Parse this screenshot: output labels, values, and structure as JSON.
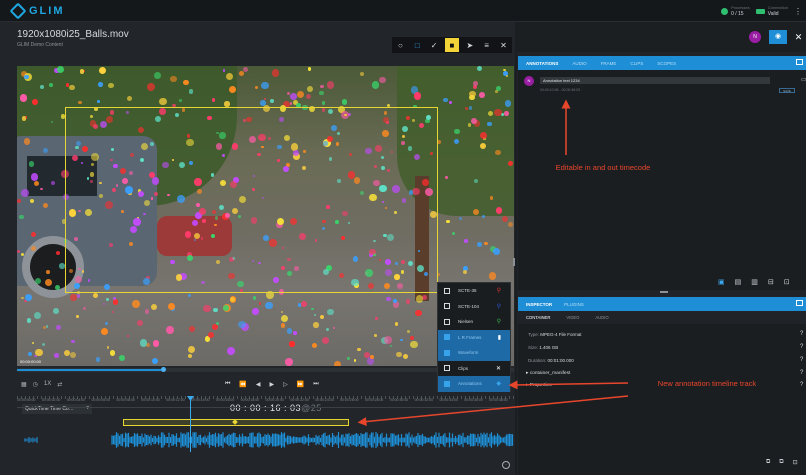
{
  "app": {
    "name": "GLIM"
  },
  "header_stats": [
    {
      "label": "Processes",
      "value": "0 / 15",
      "color": "#2fbf71"
    },
    {
      "label": "Connection",
      "value": "Valid",
      "color": "#2fbf71"
    }
  ],
  "header_menu_icon": "⋮",
  "file": {
    "title": "1920x1080i25_Balls.mov",
    "subtitle": "GLIM Demo Content"
  },
  "toolbar_icons": [
    "circle-tool",
    "rect-tool",
    "freehand-tool",
    "note-tool",
    "pointer-tool",
    "list-tool",
    "close-tool"
  ],
  "player": {
    "overlay_timecode": "00:00:00:00",
    "speed": "1X",
    "progress_fraction": 0.29,
    "transport_icons": [
      "⏮",
      "⏪",
      "◀",
      "▶",
      "▷",
      "⏩",
      "⏭"
    ]
  },
  "timeline": {
    "timecode_mode": "QuickTime Time Co…",
    "timecode": "00 : 00 : 16 : 03",
    "timecode_fps": "@25",
    "ruler_ticks": [
      "00:00:00:00",
      "00:00:02:00",
      "00:00:04:00",
      "00:00:06:00",
      "00:00:08:00",
      "00:00:10:00",
      "00:00:12:00",
      "00:00:14:00",
      "00:00:16:00",
      "00:00:18:00",
      "00:00:20:00",
      "00:00:22:00",
      "00:00:24:00",
      "00:00:26:00",
      "00:00:28:00",
      "00:00:30:00",
      "00:00:32:00",
      "00:00:34:00",
      "00:00:36:00",
      "00:00:38:00"
    ]
  },
  "track_menu": [
    {
      "label": "SCTE-35",
      "checked": false,
      "icon": "marker-red",
      "color": "#e0362c"
    },
    {
      "label": "SCTE-104",
      "checked": false,
      "icon": "marker-blue",
      "color": "#2a56d8"
    },
    {
      "label": "Nielsen",
      "checked": false,
      "icon": "marker-green",
      "color": "#3bb54a"
    },
    {
      "label": "L R Frames",
      "checked": true,
      "icon": "bar",
      "color": "#ffffff"
    },
    {
      "label": "Waveform",
      "checked": true,
      "icon": "",
      "color": ""
    },
    {
      "label": "Clips",
      "checked": false,
      "icon": "scissors",
      "color": "#ffffff"
    },
    {
      "label": "Annotations",
      "checked": true,
      "icon": "tag",
      "color": "#36a3ea"
    }
  ],
  "annotations_panel": {
    "tabs": [
      "ANNOTATIONS",
      "AUDIO",
      "FRAME",
      "CLIPS",
      "SCOPES"
    ],
    "active_tab": "ANNOTATIONS",
    "user_initial": "N",
    "item_text": "Annotation text 1234",
    "item_codes": "00:00:10:06 - 00:00:45:03",
    "item_button": "SAVE"
  },
  "inspector_panel": {
    "tabs": [
      "INSPECTOR",
      "PLUGINS"
    ],
    "active_tab": "INSPECTOR",
    "subtabs": [
      "CONTAINER",
      "VIDEO",
      "AUDIO"
    ],
    "active_subtab": "CONTAINER",
    "properties": [
      {
        "key": "Type",
        "value": "MPEG-4 File Format"
      },
      {
        "key": "Size",
        "value": "1.406 GB"
      },
      {
        "key": "Duration",
        "value": "00:01:00.000"
      }
    ],
    "tree": [
      "container_manifest",
      "Properties"
    ]
  },
  "callouts": {
    "top": "Editable in and out timecode",
    "bottom": "New annotation timeline track"
  },
  "colors": {
    "accent": "#1e8fd6",
    "annotation": "#e6d532",
    "callout": "#e8462c",
    "avatar": "#9a1ea3"
  }
}
